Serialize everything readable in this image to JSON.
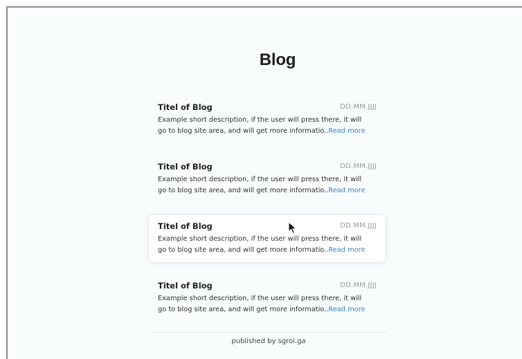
{
  "page": {
    "title": "Blog",
    "footer": "published by sgroi.ga"
  },
  "posts": [
    {
      "title": "Titel of Blog",
      "date": "DD.MM.JJJJ",
      "description_line1": "Example short description, if the user will press there, it will",
      "description_line2": "go to blog site area, and will get more informatio..",
      "read_more": "Read more"
    },
    {
      "title": "Titel of Blog",
      "date": "DD.MM.JJJJ",
      "description_line1": "Example short description, if the user will press there, it will",
      "description_line2": "go to blog site area, and will get more informatio..",
      "read_more": "Read more"
    },
    {
      "title": "Titel of Blog",
      "date": "DD.MM.JJJJ",
      "description_line1": "Example short description, if the user will press there, it will",
      "description_line2": "go to blog site area, and will get more informatio..",
      "read_more": "Read more"
    },
    {
      "title": "Titel of Blog",
      "date": "DD.MM.JJJJ",
      "description_line1": "Example short description, if the user will press there, it will",
      "description_line2": "go to blog site area, and will get more informatio..",
      "read_more": "Read more"
    }
  ],
  "colors": {
    "background": "#f9fcfc",
    "link": "#3a7fc4",
    "date": "#9a9a9a",
    "text": "#2e2e2e"
  },
  "icons": {
    "cursor": "mouse-pointer-icon"
  }
}
